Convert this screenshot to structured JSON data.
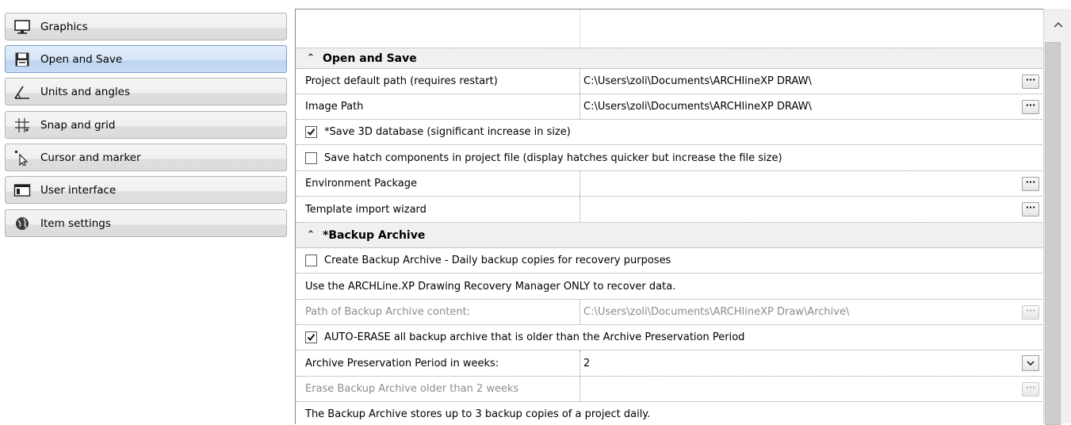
{
  "sidebar": {
    "items": [
      {
        "label": "Graphics",
        "icon": "monitor-icon",
        "active": false
      },
      {
        "label": "Open and Save",
        "icon": "floppy-disk-icon",
        "active": true
      },
      {
        "label": "Units and angles",
        "icon": "angle-icon",
        "active": false
      },
      {
        "label": "Snap and grid",
        "icon": "grid-icon",
        "active": false
      },
      {
        "label": "Cursor and marker",
        "icon": "cursor-icon",
        "active": false
      },
      {
        "label": "User interface",
        "icon": "window-icon",
        "active": false
      },
      {
        "label": "Item settings",
        "icon": "globe-gear-icon",
        "active": false
      }
    ]
  },
  "sections": {
    "open_save": {
      "title": "Open and Save",
      "project_path": {
        "label": "Project default path (requires restart)",
        "value": "C:\\Users\\zoli\\Documents\\ARCHlineXP DRAW\\"
      },
      "image_path": {
        "label": "Image Path",
        "value": "C:\\Users\\zoli\\Documents\\ARCHlineXP DRAW\\"
      },
      "save_3d": {
        "label": "*Save 3D database (significant increase in size)",
        "checked": true
      },
      "save_hatch": {
        "label": "Save hatch components in project file (display hatches quicker but increase the file size)",
        "checked": false
      },
      "env_package": {
        "label": "Environment Package",
        "value": ""
      },
      "template_wizard": {
        "label": "Template import wizard",
        "value": ""
      }
    },
    "backup": {
      "title": "*Backup Archive",
      "create_backup": {
        "label": "Create Backup Archive - Daily backup copies for recovery purposes",
        "checked": false
      },
      "recovery_note": "Use the ARCHLine.XP Drawing Recovery Manager ONLY to recover data.",
      "archive_path": {
        "label": "Path of Backup Archive content:",
        "value": "C:\\Users\\zoli\\Documents\\ARCHlineXP Draw\\Archive\\"
      },
      "auto_erase": {
        "label": "AUTO-ERASE all backup archive that is older than the Archive Preservation Period",
        "checked": true
      },
      "preservation": {
        "label": "Archive Preservation Period in weeks:",
        "value": "2"
      },
      "erase_older": {
        "label": "Erase Backup Archive older than 2 weeks",
        "value": ""
      },
      "stores_note": "The Backup Archive stores up to 3 backup copies of a project daily."
    }
  },
  "buttons": {
    "browse": "···"
  },
  "colors": {
    "active_nav": "#c6dcf5",
    "section_bg": "#f0f0f0",
    "disabled_text": "#8c8c8c"
  }
}
